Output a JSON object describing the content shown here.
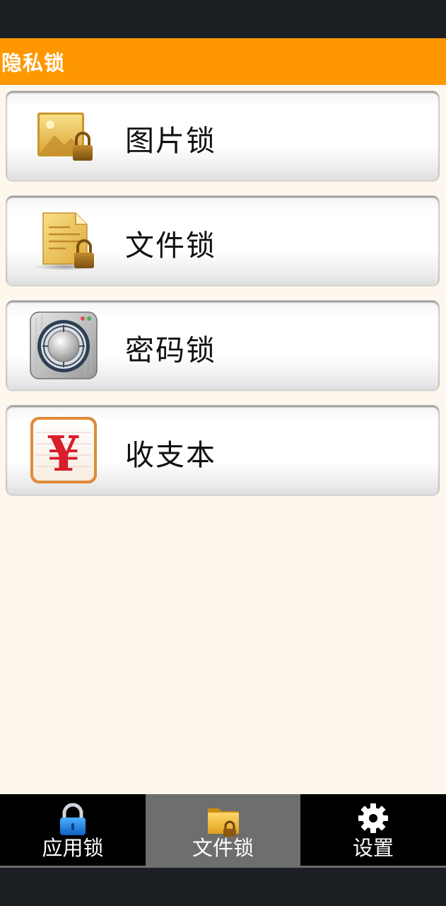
{
  "header": {
    "title": "隐私锁"
  },
  "menu": {
    "items": [
      {
        "id": "image-lock",
        "label": "图片锁",
        "icon": "image-lock-icon"
      },
      {
        "id": "file-lock",
        "label": "文件锁",
        "icon": "document-lock-icon"
      },
      {
        "id": "password-lock",
        "label": "密码锁",
        "icon": "safe-dial-icon"
      },
      {
        "id": "ledger",
        "label": "收支本",
        "icon": "yuan-icon"
      }
    ]
  },
  "tabs": {
    "active": "file-lock",
    "items": [
      {
        "id": "app-lock",
        "label": "应用锁",
        "icon": "padlock-icon"
      },
      {
        "id": "file-lock",
        "label": "文件锁",
        "icon": "folder-lock-icon"
      },
      {
        "id": "settings",
        "label": "设置",
        "icon": "gear-icon"
      }
    ]
  },
  "icons": {
    "yuan_symbol": "¥"
  },
  "colors": {
    "title_bar": "#ff9800",
    "content_bg": "#fdf7ee",
    "tab_bar": "#000000",
    "tab_active": "#6e6e6e"
  }
}
